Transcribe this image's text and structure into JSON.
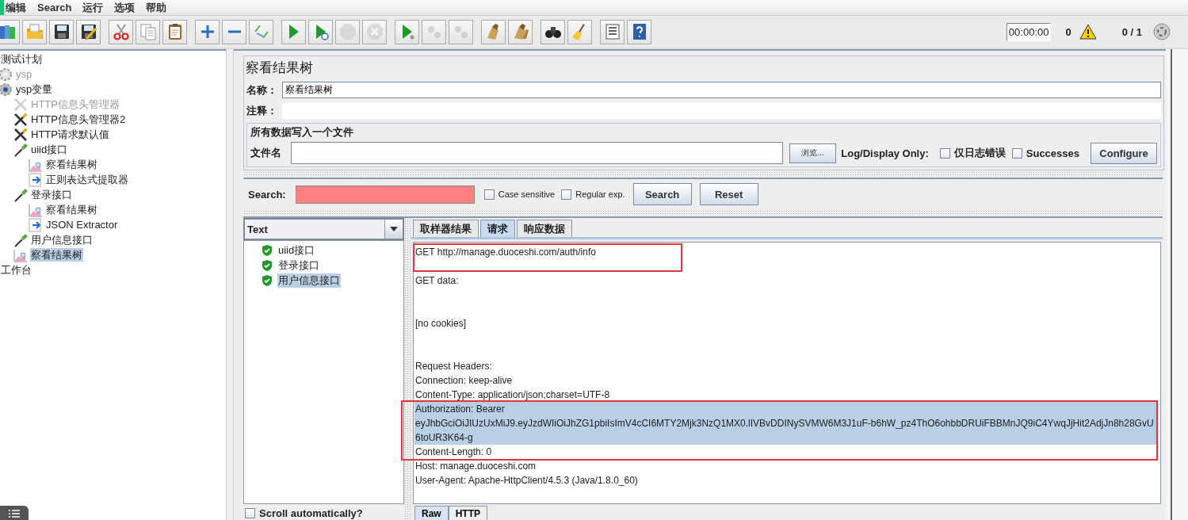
{
  "menu": [
    "编辑",
    "Search",
    "运行",
    "选项",
    "帮助"
  ],
  "toolbar": [
    [
      {
        "kind": "templates",
        "disabled": false
      },
      {
        "kind": "open",
        "disabled": false
      },
      {
        "kind": "save",
        "disabled": false
      },
      {
        "kind": "save-as",
        "disabled": false
      }
    ],
    [
      {
        "kind": "cut",
        "disabled": false
      },
      {
        "kind": "copy",
        "disabled": false
      },
      {
        "kind": "paste",
        "disabled": false
      }
    ],
    [
      {
        "kind": "expand",
        "disabled": false
      },
      {
        "kind": "collapse",
        "disabled": false
      },
      {
        "kind": "toggle",
        "disabled": false
      }
    ],
    [
      {
        "kind": "start",
        "disabled": false
      },
      {
        "kind": "start-no-pauses",
        "disabled": false
      },
      {
        "kind": "stop",
        "disabled": true
      },
      {
        "kind": "shutdown",
        "disabled": true
      }
    ],
    [
      {
        "kind": "remote-start",
        "disabled": false
      },
      {
        "kind": "remote-start-all",
        "disabled": true
      },
      {
        "kind": "remote-stop",
        "disabled": true
      }
    ],
    [
      {
        "kind": "clear",
        "disabled": false
      },
      {
        "kind": "clear-all",
        "disabled": false
      }
    ],
    [
      {
        "kind": "search",
        "disabled": false
      },
      {
        "kind": "reset-search",
        "disabled": false
      }
    ],
    [
      {
        "kind": "function-helper",
        "disabled": false
      },
      {
        "kind": "help",
        "disabled": false
      }
    ]
  ],
  "status": {
    "timer": "00:00:00",
    "warnings": "0",
    "threads": "0 / 1"
  },
  "tree": [
    {
      "label": "测试计划",
      "disabled": false,
      "selected": false,
      "children": [
        {
          "label": "ysp",
          "kind": "gear",
          "disabled": true,
          "selected": false
        },
        {
          "label": "ysp变量",
          "kind": "gear",
          "disabled": false,
          "selected": false,
          "children": [
            {
              "label": "HTTP信息头管理器",
              "kind": "tools",
              "disabled": true,
              "selected": false
            },
            {
              "label": "HTTP信息头管理器2",
              "kind": "tools",
              "disabled": false,
              "selected": false
            },
            {
              "label": "HTTP请求默认值",
              "kind": "tools",
              "disabled": false,
              "selected": false
            },
            {
              "label": "uiid接口",
              "kind": "sampler",
              "disabled": false,
              "selected": false,
              "children": [
                {
                  "label": "察看结果树",
                  "kind": "listener",
                  "disabled": false,
                  "selected": false
                },
                {
                  "label": "正则表达式提取器",
                  "kind": "extractor",
                  "disabled": false,
                  "selected": false
                }
              ]
            },
            {
              "label": "登录接口",
              "kind": "sampler",
              "disabled": false,
              "selected": false,
              "children": [
                {
                  "label": "察看结果树",
                  "kind": "listener",
                  "disabled": false,
                  "selected": false
                },
                {
                  "label": "JSON Extractor",
                  "kind": "extractor",
                  "disabled": false,
                  "selected": false
                }
              ]
            },
            {
              "label": "用户信息接口",
              "kind": "sampler",
              "disabled": false,
              "selected": false
            },
            {
              "label": "察看结果树",
              "kind": "listener",
              "disabled": false,
              "selected": true
            }
          ]
        }
      ]
    },
    {
      "label": "工作台",
      "disabled": false,
      "selected": false
    }
  ],
  "panel": {
    "title": "察看结果树",
    "name_label": "名称：",
    "name_value": "察看结果树",
    "comment_label": "注释：",
    "file_section": {
      "legend": "所有数据写入一个文件",
      "file_label": "文件名",
      "browse": "浏览...",
      "log_label": "Log/Display Only:",
      "checks": [
        {
          "label": "仅日志错误",
          "checked": false
        },
        {
          "label": "Successes",
          "checked": false
        }
      ],
      "configure": "Configure"
    },
    "search": {
      "label": "Search:",
      "checks": [
        {
          "label": "Case sensitive",
          "checked": false
        },
        {
          "label": "Regular exp.",
          "checked": false
        }
      ],
      "buttons": [
        "Search",
        "Reset"
      ]
    },
    "renderer": "Text",
    "results": [
      {
        "label": "uiid接口",
        "selected": false
      },
      {
        "label": "登录接口",
        "selected": false
      },
      {
        "label": "用户信息接口",
        "selected": true
      }
    ],
    "scroll_auto": {
      "label": "Scroll automatically?",
      "checked": false
    },
    "tabs": [
      {
        "label": "取样器结果",
        "selected": false
      },
      {
        "label": "请求",
        "selected": true
      },
      {
        "label": "响应数据",
        "selected": false
      }
    ],
    "sections": [
      {
        "boxed": true,
        "lines": [
          {
            "text": "GET http://manage.duoceshi.com/auth/info",
            "selected": false
          }
        ]
      },
      {
        "boxed": false,
        "lines": [
          {
            "text": "GET data:",
            "selected": false
          }
        ]
      },
      {
        "boxed": false,
        "lines": [
          {
            "text": "[no cookies]",
            "selected": false
          }
        ]
      },
      {
        "boxed": false,
        "lines": [
          {
            "text": "Request Headers:",
            "selected": false
          },
          {
            "text": "Connection: keep-alive",
            "selected": false
          },
          {
            "text": "Content-Type: application/json;charset=UTF-8",
            "selected": false
          }
        ]
      },
      {
        "boxed": true,
        "lines": [
          {
            "text": "Authorization: Bearer",
            "selected": true
          },
          {
            "text": "eyJhbGciOiJIUzUxMiJ9.eyJzdWIiOiJhZG1pbiIsImV4cCI6MTY2Mjk3NzQ1MX0.lIVBvDDINySVMW6M3J1uF-b6hW_pz4ThO6ohbbDRUiFBBMnJQ9iC4YwqJjHit2AdjJn8h28GvU",
            "selected": true
          },
          {
            "text": "6toUR3K64-g",
            "selected": true
          },
          {
            "text": "Content-Length: 0",
            "selected": false
          }
        ]
      },
      {
        "boxed": false,
        "lines": [
          {
            "text": "Host: manage.duoceshi.com",
            "selected": false
          },
          {
            "text": "User-Agent: Apache-HttpClient/4.5.3 (Java/1.8.0_60)",
            "selected": false
          }
        ]
      }
    ],
    "bottom_tabs": [
      {
        "label": "Raw",
        "selected": true
      },
      {
        "label": "HTTP",
        "selected": false
      }
    ]
  }
}
